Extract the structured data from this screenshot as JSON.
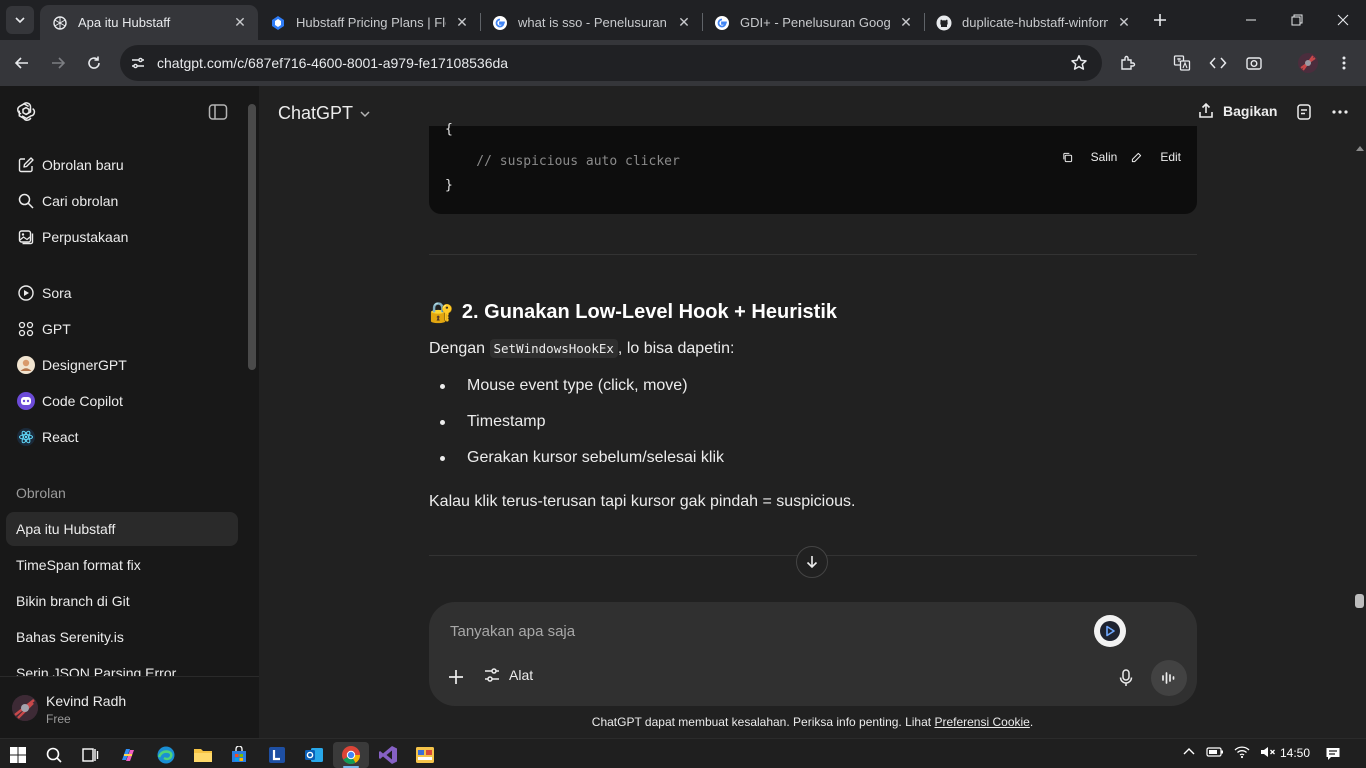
{
  "browser": {
    "tabs": [
      {
        "title": "Apa itu Hubstaff",
        "active": true,
        "icon": "chatgpt-icon"
      },
      {
        "title": "Hubstaff Pricing Plans | Flexib",
        "active": false,
        "icon": "hubstaff-icon"
      },
      {
        "title": "what is sso - Penelusuran Go",
        "active": false,
        "icon": "google-icon"
      },
      {
        "title": "GDI+ - Penelusuran Google",
        "active": false,
        "icon": "google-icon"
      },
      {
        "title": "duplicate-hubstaff-winform/",
        "active": false,
        "icon": "github-icon"
      }
    ],
    "url": "chatgpt.com/c/687ef716-4600-8001-a979-fe17108536da"
  },
  "sidebar": {
    "primary": [
      {
        "label": "Obrolan baru",
        "icon": "new-chat-icon"
      },
      {
        "label": "Cari obrolan",
        "icon": "search-icon"
      },
      {
        "label": "Perpustakaan",
        "icon": "library-icon"
      }
    ],
    "gpts": [
      {
        "label": "Sora",
        "icon": "sora-icon"
      },
      {
        "label": "GPT",
        "icon": "gpt-grid-icon"
      },
      {
        "label": "DesignerGPT",
        "icon": "designergpt-icon"
      },
      {
        "label": "Code Copilot",
        "icon": "code-copilot-icon"
      },
      {
        "label": "React",
        "icon": "react-icon"
      }
    ],
    "section_title": "Obrolan",
    "history": [
      {
        "label": "Apa itu Hubstaff",
        "active": true
      },
      {
        "label": "TimeSpan format fix",
        "active": false
      },
      {
        "label": "Bikin branch di Git",
        "active": false
      },
      {
        "label": "Bahas Serenity.is",
        "active": false
      },
      {
        "label": "Serin JSON Parsing Error",
        "active": false
      }
    ],
    "user": {
      "name": "Kevind Radh",
      "plan": "Free"
    }
  },
  "header": {
    "model": "ChatGPT",
    "share_label": "Bagikan"
  },
  "conversation": {
    "code": {
      "lines": [
        "{",
        "    // suspicious auto clicker",
        "}"
      ],
      "copy_label": "Salin",
      "edit_label": "Edit"
    },
    "heading_emoji": "🔐",
    "heading": "2. Gunakan Low-Level Hook + Heuristik",
    "intro_before": "Dengan ",
    "intro_code": "SetWindowsHookEx",
    "intro_after": ", lo bisa dapetin:",
    "bullets": [
      "Mouse event type (click, move)",
      "Timestamp",
      "Gerakan kursor sebelum/selesai klik"
    ],
    "conclusion": "Kalau klik terus-terusan tapi kursor gak pindah = suspicious."
  },
  "composer": {
    "placeholder": "Tanyakan apa saja",
    "tools_label": "Alat"
  },
  "disclaimer": {
    "text": "ChatGPT dapat membuat kesalahan. Periksa info penting. Lihat ",
    "link": "Preferensi Cookie",
    "end": "."
  },
  "taskbar": {
    "time": "14:50"
  }
}
